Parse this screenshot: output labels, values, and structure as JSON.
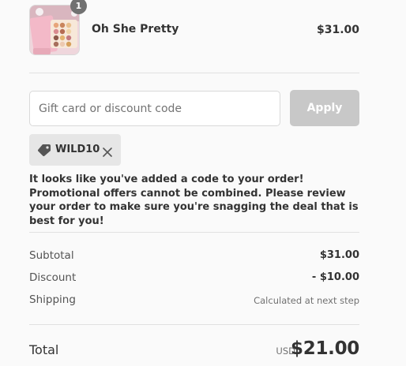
{
  "cart": {
    "item": {
      "quantity": "1",
      "name": "Oh She Pretty",
      "price": "$31.00",
      "image": "eyeshadow-palette-product-photo"
    }
  },
  "discount": {
    "placeholder": "Gift card or discount code",
    "apply_label": "Apply",
    "applied_code": "WILD10",
    "notice": "It looks like you've added a code to your order! Promotional offers cannot be combined. Please review your order to make sure you're snagging the deal that is best for you!"
  },
  "summary": {
    "subtotal_label": "Subtotal",
    "subtotal_value": "$31.00",
    "discount_label": "Discount",
    "discount_value": "- $10.00",
    "shipping_label": "Shipping",
    "shipping_value": "Calculated at next step",
    "total_label": "Total",
    "total_currency": "USD",
    "total_value": "$21.00"
  },
  "colors": {
    "background": "#fafafa",
    "text": "#333333",
    "muted": "#717171",
    "button_disabled": "#c8c8c8",
    "tag_background": "#e6e6e6",
    "divider": "#e1e1e1"
  },
  "icons": [
    "discount-tag-icon",
    "close-icon"
  ]
}
